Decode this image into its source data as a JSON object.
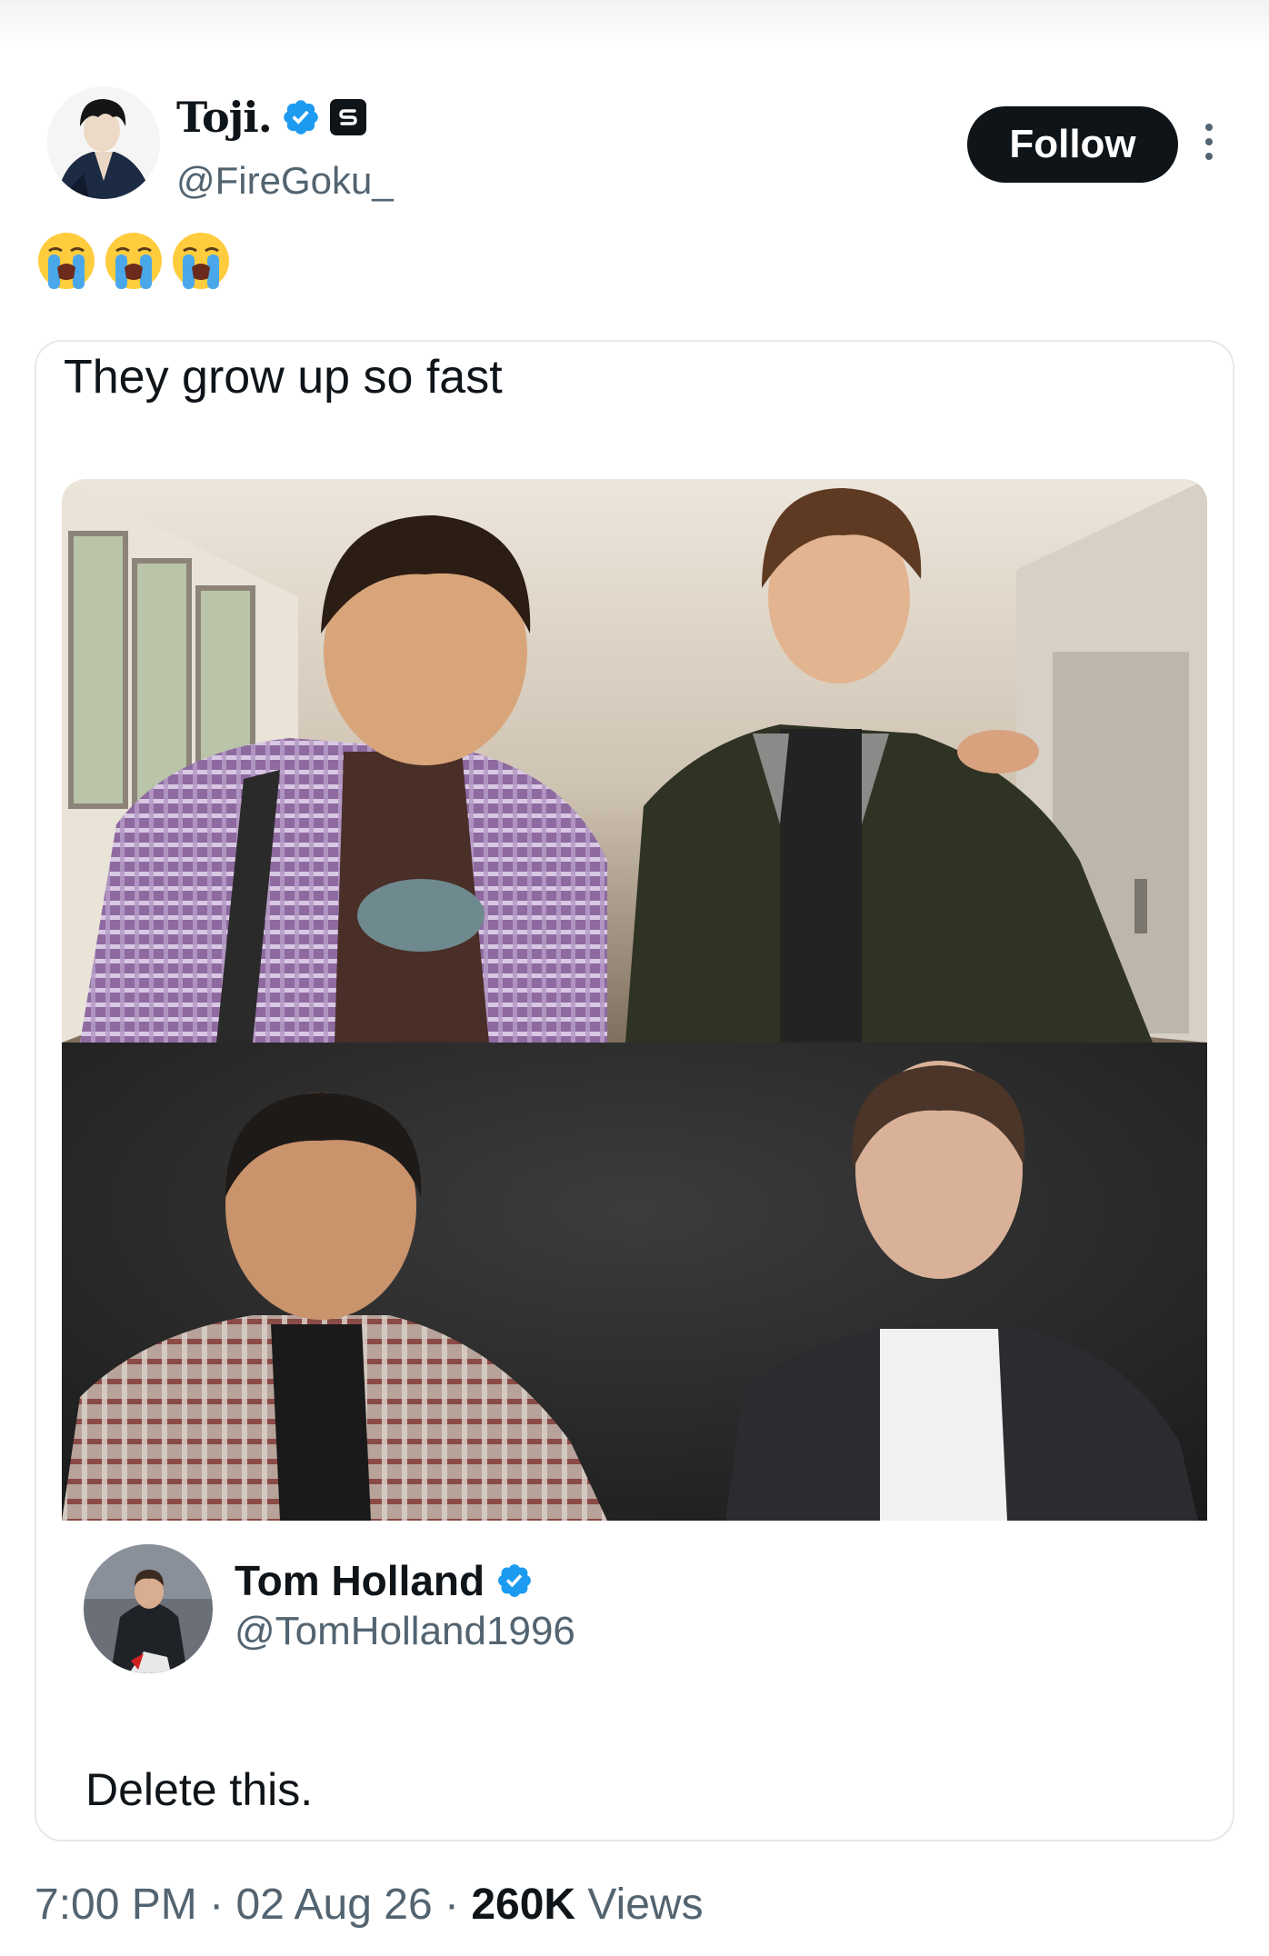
{
  "tweet": {
    "author": {
      "display_name": "Toji.",
      "handle": "@FireGoku_",
      "verified": true,
      "avatar_icon": "anime-character-avatar"
    },
    "follow_label": "Follow",
    "more_icon": "more-options-icon",
    "text_emojis": [
      "😭",
      "😭",
      "😭"
    ]
  },
  "card": {
    "caption": "They grow up so fast",
    "image_icon": "meme-photo-four-people",
    "embedded_tweet": {
      "display_name": "Tom Holland",
      "handle": "@TomHolland1996",
      "verified": true,
      "text": "Delete this."
    }
  },
  "meta": {
    "time": "7:00 PM",
    "separator": "·",
    "date": "02 Aug 26",
    "views_count": "260K",
    "views_label": "Views"
  },
  "colors": {
    "text_primary": "#0f1419",
    "text_secondary": "#536471",
    "verified_blue": "#1d9bf0",
    "follow_bg": "#0f1419"
  }
}
